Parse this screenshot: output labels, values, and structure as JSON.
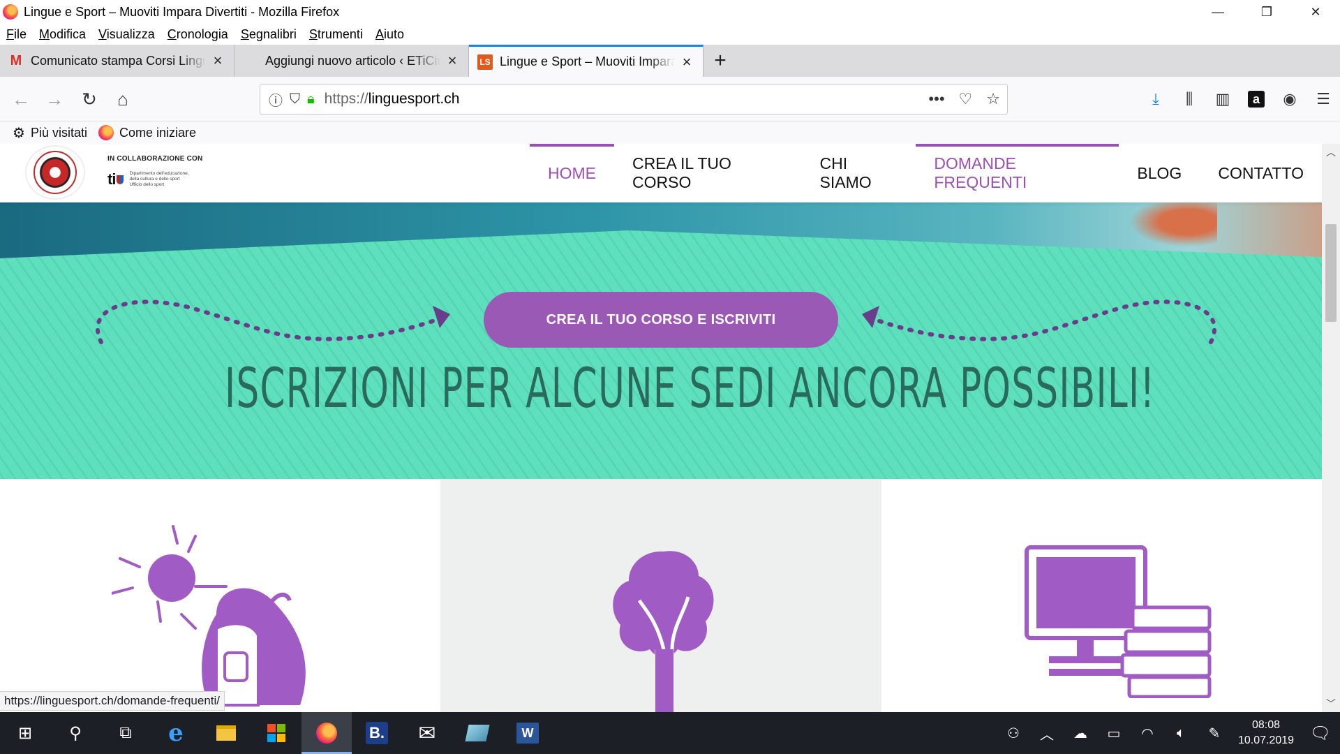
{
  "window": {
    "title": "Lingue e Sport – Muoviti Impara Divertiti - Mozilla Firefox",
    "controls": [
      "—",
      "❐",
      "✕"
    ]
  },
  "menu": [
    "File",
    "Modifica",
    "Visualizza",
    "Cronologia",
    "Segnalibri",
    "Strumenti",
    "Aiuto"
  ],
  "tabs": [
    {
      "label": "Comunicato stampa Corsi Lingue e Sport",
      "favicon": "gmail-icon",
      "active": false
    },
    {
      "label": "Aggiungi nuovo articolo ‹ ETiCinforma",
      "favicon": "wordpress-icon",
      "active": false
    },
    {
      "label": "Lingue e Sport – Muoviti Impara Divertiti",
      "favicon": "linguesport-icon",
      "active": true
    }
  ],
  "newtab_label": "+",
  "urlbar": {
    "protocol": "https://",
    "domain": "linguesport.ch",
    "more": "•••"
  },
  "bookmarks": [
    {
      "label": "Più visitati",
      "icon": "gear-icon"
    },
    {
      "label": "Come iniziare",
      "icon": "firefox-icon"
    }
  ],
  "site": {
    "collab_label": "IN COLLABORAZIONE CON",
    "ti_text": "ti",
    "ti_dept_lines": [
      "Dipartimento dell'educazione,",
      "della cultura e dello sport",
      "Ufficio dello sport"
    ],
    "nav": [
      {
        "label": "HOME",
        "highlight": true,
        "bar": true
      },
      {
        "label": "CREA IL TUO CORSO",
        "highlight": false,
        "bar": false
      },
      {
        "label": "CHI SIAMO",
        "highlight": false,
        "bar": false
      },
      {
        "label": "DOMANDE FREQUENTI",
        "highlight": true,
        "bar": true
      },
      {
        "label": "BLOG",
        "highlight": false,
        "bar": false
      },
      {
        "label": "CONTATTO",
        "highlight": false,
        "bar": false
      }
    ],
    "cta_label": "CREA IL TUO CORSO E ISCRIVITI",
    "hero_title": "ISCRIZIONI PER ALCUNE SEDI ANCORA POSSIBILI!",
    "colors": {
      "purple": "#9b59b6",
      "mint": "#5ee0bd",
      "hero_text": "#2a6a5c",
      "feature_icon": "#a05cc4"
    },
    "features": [
      {
        "icon": "sun-backpack-icon"
      },
      {
        "icon": "tree-icon"
      },
      {
        "icon": "computer-books-icon"
      }
    ]
  },
  "status_url": "https://linguesport.ch/domande-frequenti/",
  "taskbar": {
    "clock_time": "08:08",
    "clock_date": "10.07.2019"
  }
}
